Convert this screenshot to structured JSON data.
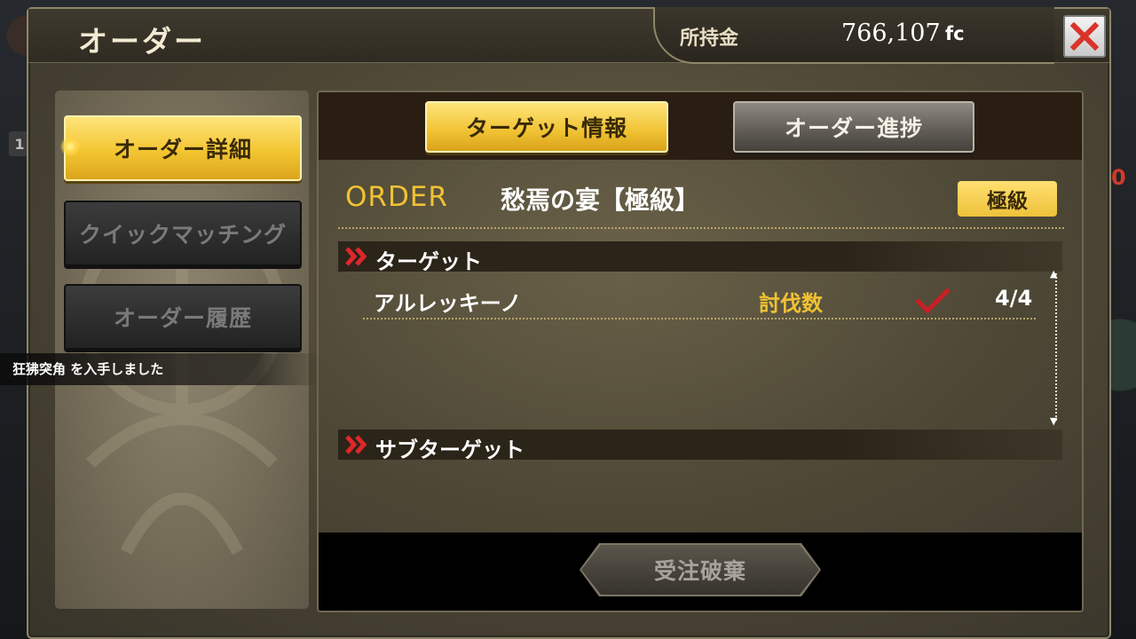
{
  "window": {
    "title": "オーダー",
    "money_label": "所持金",
    "money_value": "766,107",
    "money_unit": "fc",
    "close_icon": "close-icon"
  },
  "sidebar": {
    "buttons": [
      {
        "label": "オーダー詳細",
        "state": "active"
      },
      {
        "label": "クイックマッチング",
        "state": "disabled"
      },
      {
        "label": "オーダー履歴",
        "state": "disabled"
      }
    ]
  },
  "notification": {
    "text": "狂狒突角 を入手しました"
  },
  "tabs": [
    {
      "label": "ターゲット情報",
      "state": "active"
    },
    {
      "label": "オーダー進捗",
      "state": "inactive"
    }
  ],
  "order": {
    "prefix": "ORDER",
    "name": "愁焉の宴【極級】",
    "grade": "極級"
  },
  "sections": {
    "target_label": "ターゲット",
    "subtarget_label": "サブターゲット"
  },
  "targets": [
    {
      "name": "アルレッキーノ",
      "condition": "討伐数",
      "completed": true,
      "progress": "4/4"
    }
  ],
  "actions": {
    "discard_label": "受注破棄"
  },
  "colors": {
    "accent_gold": "#f0c233",
    "chevron_red": "#e0262a"
  }
}
